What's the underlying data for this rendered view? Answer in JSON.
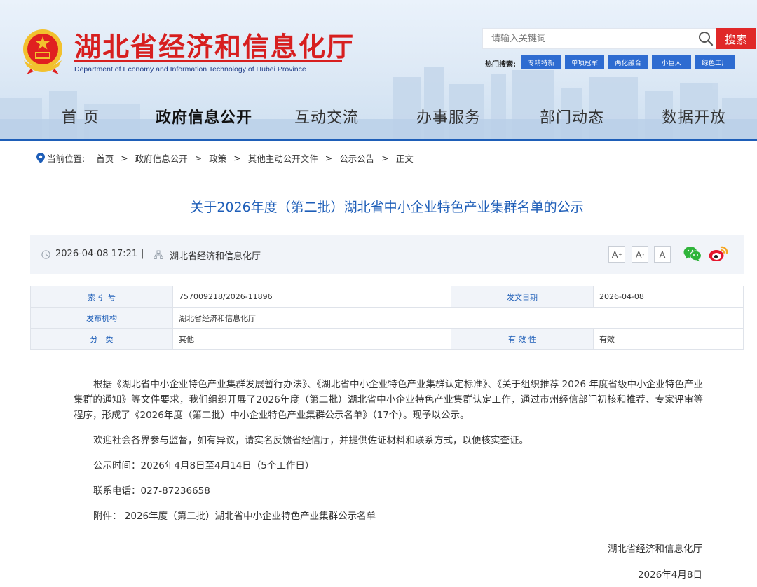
{
  "site": {
    "title": "湖北省经济和信息化厅",
    "subtitle": "Department of Economy and Information Technology of Hubei Province"
  },
  "search": {
    "placeholder": "请输入关键词",
    "button_label": "搜索",
    "hot_label": "热门搜索:",
    "hot_tags": [
      "专精特新",
      "单项冠军",
      "两化融合",
      "小巨人",
      "绿色工厂"
    ]
  },
  "nav": {
    "items": [
      "首  页",
      "政府信息公开",
      "互动交流",
      "办事服务",
      "部门动态",
      "数据开放"
    ],
    "active": "政府信息公开"
  },
  "breadcrumb": {
    "prefix": "当前位置:",
    "items": [
      "首页",
      "政府信息公开",
      "政策",
      "其他主动公开文件",
      "公示公告",
      "正文"
    ],
    "separator": ">"
  },
  "article": {
    "title": "关于2026年度（第二批）湖北省中小企业特色产业集群名单的公示",
    "datetime": "2026-04-08 17:21",
    "divider": "|",
    "publisher": "湖北省经济和信息化厅",
    "font_buttons": [
      "A",
      "A",
      "A"
    ]
  },
  "meta": {
    "index_label": "索 引 号",
    "index_value": "757009218/2026-11896",
    "date_label": "发文日期",
    "date_value": "2026-04-08",
    "org_label": "发布机构",
    "org_value": "湖北省经济和信息化厅",
    "category_label": "分　类",
    "category_value": "其他",
    "validity_label": "有 效 性",
    "validity_value": "有效"
  },
  "body": {
    "paragraph1": "根据《湖北省中小企业特色产业集群发展暂行办法》、《湖北省中小企业特色产业集群认定标准》、《关于组织推荐 2026 年度省级中小企业特色产业集群的通知》等文件要求，我们组织开展了2026年度（第二批）湖北省中小企业特色产业集群认定工作，通过市州经信部门初核和推荐、专家评审等程序，形成了《2026年度（第二批）中小企业特色产业集群公示名单》（17个）。现予以公示。",
    "paragraph2": "欢迎社会各界参与监督，如有异议，请实名反馈省经信厅，并提供佐证材料和联系方式，以便核实查证。",
    "period": "公示时间：2026年4月8日至4月14日（5个工作日）",
    "phone": "联系电话：027-87236658",
    "attachment": "附件：  2026年度（第二批）湖北省中小企业特色产业集群公示名单",
    "sign_org": "湖北省经济和信息化厅",
    "sign_date": "2026年4月8日"
  },
  "colors": {
    "brand_red": "#d71f1f",
    "brand_blue": "#1e5eb8",
    "tag_blue": "#2e6cd1",
    "search_red": "#e02828"
  }
}
